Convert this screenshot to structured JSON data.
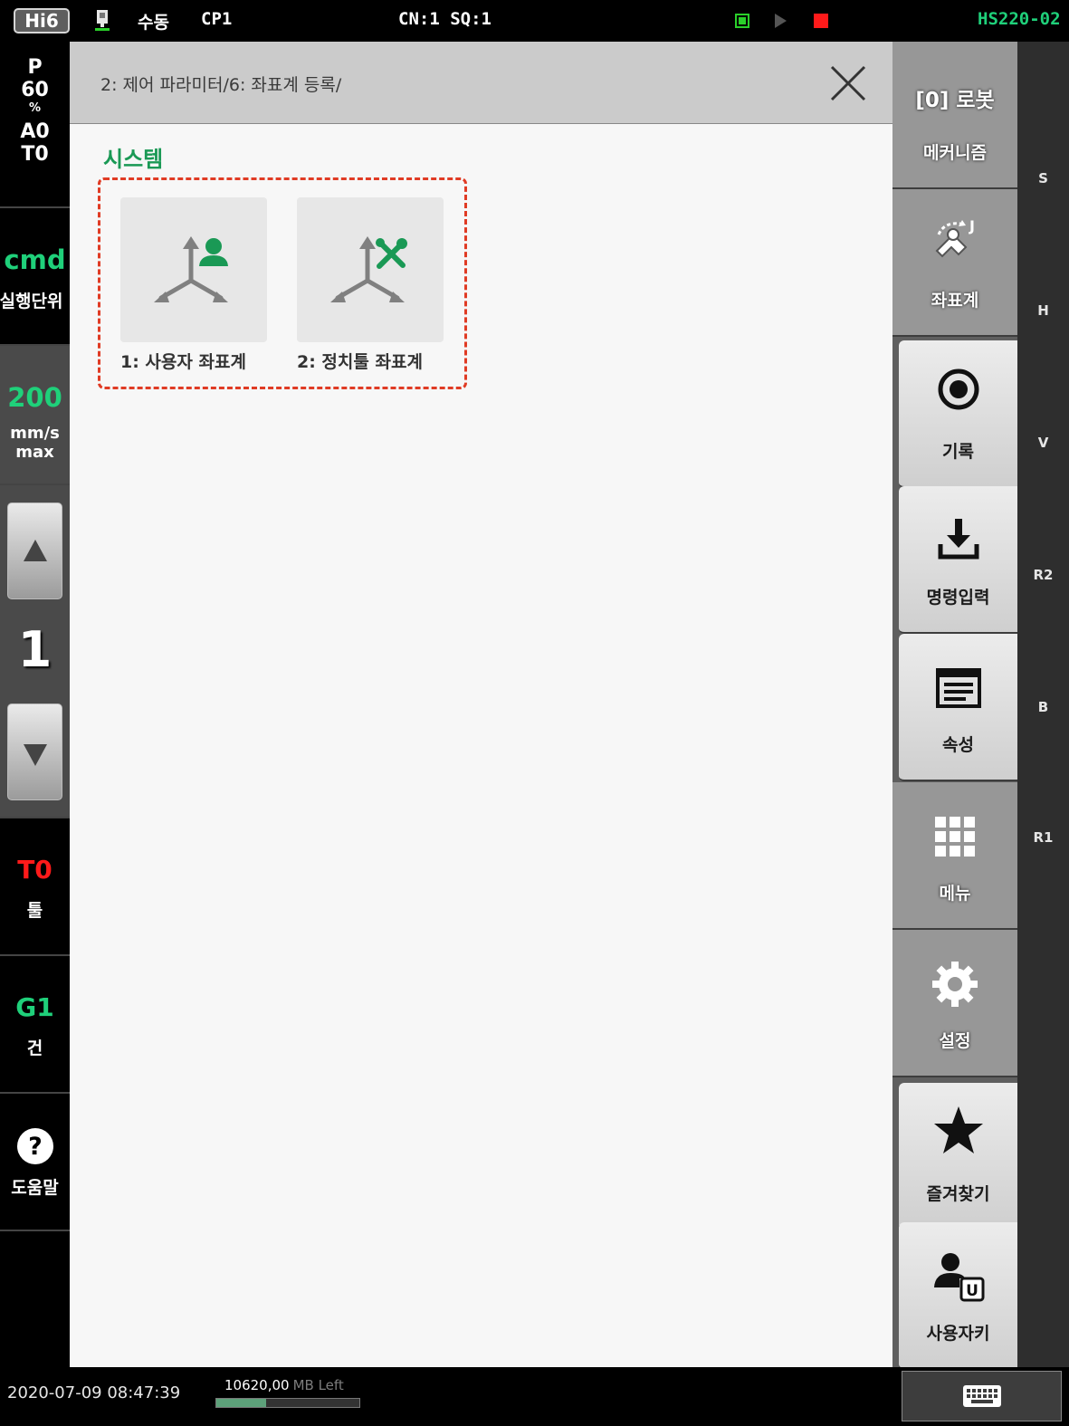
{
  "topbar": {
    "logo": "Hi6",
    "mode": "수동",
    "program": "CP1",
    "cn_sq": "CN:1 SQ:1",
    "model": "HS220-02",
    "colors": {
      "run_indicator": "#2ad02a",
      "stop_indicator": "#ff1a1a",
      "model": "#1fd07a"
    }
  },
  "left": {
    "override_label": "P",
    "override_value": "60",
    "override_unit": "%",
    "a_value": "A0",
    "t_value": "T0",
    "cmd": "cmd",
    "cmd_sub": "실행단위",
    "speed": "200",
    "speed_unit": "mm/s",
    "speed_mode": "max",
    "step": "1",
    "tool": "T0",
    "tool_label": "툴",
    "gun": "G1",
    "gun_label": "건",
    "help_label": "도움말"
  },
  "content": {
    "path": "2: 제어 파라미터/6: 좌표계 등록/",
    "section_title": "시스템",
    "tiles": [
      {
        "label": "1: 사용자 좌표계",
        "icon": "user-coordinate-icon"
      },
      {
        "label": "2: 정치툴 좌표계",
        "icon": "fixed-tool-coordinate-icon"
      }
    ],
    "colors": {
      "section_title": "#1a9955",
      "highlight_border": "#e03b24",
      "icon_accent": "#1a9955"
    }
  },
  "right": {
    "robot_prefix": "[0] 로봇",
    "mechanism": "메커니즘",
    "coord": "좌표계",
    "record": "기록",
    "command_input": "명령입력",
    "property": "속성",
    "menu": "메뉴",
    "settings": "설정",
    "favorites": "즐겨찾기",
    "user_key": "사용자키"
  },
  "axes": [
    "S",
    "H",
    "V",
    "R2",
    "B",
    "R1"
  ],
  "bottom": {
    "datetime": "2020-07-09 08:47:39",
    "memory": "10620,00",
    "memory_unit": "MB Left",
    "memory_fill_fraction": 0.35
  }
}
